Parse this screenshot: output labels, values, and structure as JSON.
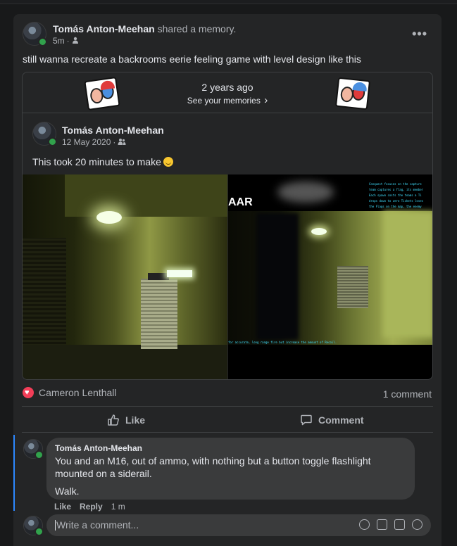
{
  "post": {
    "author": "Tomás Anton-Meehan",
    "action": "shared a memory.",
    "time": "5m",
    "dot": "·",
    "text": "still wanna recreate a backrooms eerie feeling game with level design like this",
    "more": "•••"
  },
  "memory": {
    "years_ago": "2 years ago",
    "see_memories": "See your memories",
    "chevron": "›",
    "inner_author": "Tomás Anton-Meehan",
    "inner_date": "12 May 2020",
    "inner_dot": "·",
    "inner_text": "This took 20 minutes to make",
    "photo2_overlay": "AAR",
    "photo2_side_text": "Conquest focuses on the capture\nteam captures a flag, its member\nEach spawn costs the teams a Ti\ndrops down to zero Tickets loses\nthe Flags on the map, the enemy",
    "photo2_bottom_text": "for accurate, long range fire but increase the amount of Recoil."
  },
  "reactions": {
    "name": "Cameron Lenthall",
    "comments": "1 comment"
  },
  "actions": {
    "like": "Like",
    "comment": "Comment"
  },
  "comment": {
    "author": "Tomás Anton-Meehan",
    "text": "You and an M16, out of ammo, with nothing but a button toggle flashlight mounted on a siderail.",
    "walk": "Walk.",
    "like": "Like",
    "reply": "Reply",
    "time": "1 m"
  },
  "composer": {
    "placeholder": "Write a comment..."
  },
  "colors": {
    "background": "#18191a",
    "card": "#242526",
    "accent": "#2d88ff",
    "heart": "#f33e58",
    "online": "#31a24c"
  }
}
